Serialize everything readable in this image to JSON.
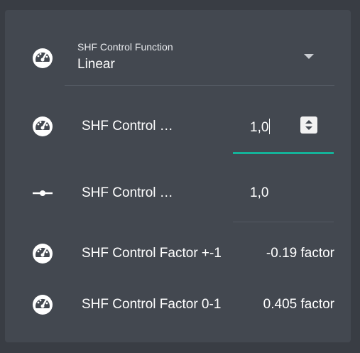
{
  "select": {
    "caption": "SHF Control Function",
    "value": "Linear"
  },
  "rows": [
    {
      "label": "SHF Control …",
      "value": "1,0",
      "icon": "gauge-icon",
      "editable": true
    },
    {
      "label": "SHF Control …",
      "value": "1,0",
      "icon": "slider-icon",
      "editable": false
    },
    {
      "label": "SHF Control Factor +-1",
      "value": "-0.19 factor",
      "icon": "gauge-icon",
      "editable": false
    },
    {
      "label": "SHF Control Factor 0-1",
      "value": "0.405 factor",
      "icon": "gauge-icon",
      "editable": false
    }
  ],
  "colors": {
    "background": "#393d44",
    "card": "#434850",
    "accent": "#14b39a",
    "divider": "#545a63"
  }
}
